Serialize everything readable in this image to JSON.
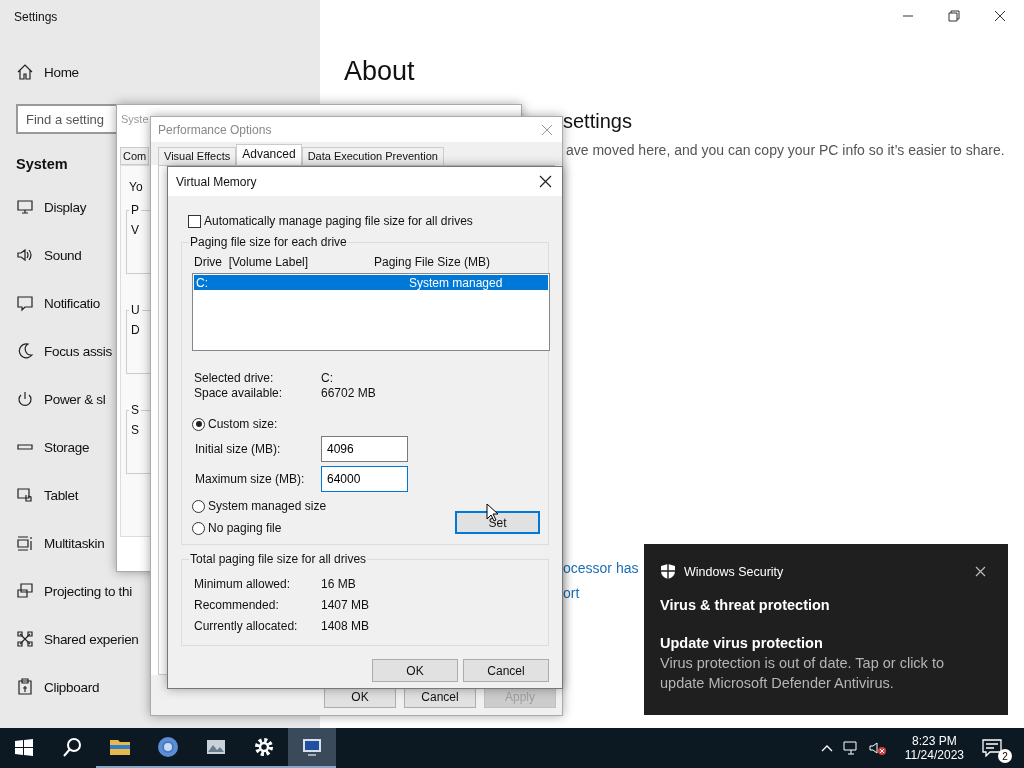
{
  "settings": {
    "title": "Settings",
    "home": "Home",
    "search": {
      "placeholder": "Find a setting"
    },
    "section": "System",
    "items": [
      {
        "kind": "display",
        "label": "Display"
      },
      {
        "kind": "sound",
        "label": "Sound"
      },
      {
        "kind": "notifications",
        "label": "Notificatio"
      },
      {
        "kind": "focus",
        "label": "Focus assis"
      },
      {
        "kind": "power",
        "label": "Power & sl"
      },
      {
        "kind": "storage",
        "label": "Storage"
      },
      {
        "kind": "tablet",
        "label": "Tablet"
      },
      {
        "kind": "multitasking",
        "label": "Multitaskin"
      },
      {
        "kind": "projecting",
        "label": "Projecting to thi"
      },
      {
        "kind": "shared",
        "label": "Shared experien"
      },
      {
        "kind": "clipboard",
        "label": "Clipboard"
      }
    ],
    "heading": "About",
    "subheading": "settings",
    "description": "ave moved here, and you can copy your PC info so it’s easier to share.",
    "links": [
      "ocessor has",
      "ort"
    ]
  },
  "system_properties": {
    "title": "Syste",
    "tab": "Com",
    "intro": "Yo",
    "groups": [
      {
        "label": "P",
        "text": "V"
      },
      {
        "label": "U",
        "text": "D"
      },
      {
        "label": "S",
        "text": "S"
      }
    ]
  },
  "performance_options": {
    "title": "Performance Options",
    "tabs": [
      {
        "label": "Visual Effects",
        "selected": false
      },
      {
        "label": "Advanced",
        "selected": true
      },
      {
        "label": "Data Execution Prevention",
        "selected": false
      }
    ],
    "buttons": [
      {
        "label": "OK",
        "disabled": false
      },
      {
        "label": "Cancel",
        "disabled": false
      },
      {
        "label": "Apply",
        "disabled": true
      }
    ]
  },
  "virtual_memory": {
    "title": "Virtual Memory",
    "auto_manage": {
      "label": "Automatically manage paging file size for all drives",
      "checked": false
    },
    "group_title": "Paging file size for each drive",
    "columns": [
      "Drive  [Volume Label]",
      "Paging File Size (MB)"
    ],
    "drives": [
      {
        "drive": "C:",
        "size": "System managed",
        "selected": true
      }
    ],
    "info": [
      {
        "label": "Selected drive:",
        "value": "C:"
      },
      {
        "label": "Space available:",
        "value": "66702 MB"
      }
    ],
    "options": [
      {
        "kind": "radio",
        "label": "Custom size:",
        "selected": true
      },
      {
        "kind": "field",
        "label": "Initial size (MB):",
        "value": "4096",
        "focused": false
      },
      {
        "kind": "field",
        "label": "Maximum size (MB):",
        "value": "64000",
        "focused": true
      },
      {
        "kind": "radio",
        "label": "System managed size",
        "selected": false
      },
      {
        "kind": "radio",
        "label": "No paging file",
        "selected": false
      }
    ],
    "set_button": "Set",
    "totals_title": "Total paging file size for all drives",
    "totals": [
      {
        "label": "Minimum allowed:",
        "value": "16 MB"
      },
      {
        "label": "Recommended:",
        "value": "1407 MB"
      },
      {
        "label": "Currently allocated:",
        "value": "1408 MB"
      }
    ],
    "buttons": [
      "OK",
      "Cancel"
    ]
  },
  "toast": {
    "app": "Windows Security",
    "title": "Virus & threat protection",
    "heading": "Update virus protection",
    "body": "Virus protection is out of date. Tap or click to update Microsoft Defender Antivirus."
  },
  "taskbar": {
    "apps": [
      {
        "kind": "start",
        "running": false,
        "active": false
      },
      {
        "kind": "search",
        "running": false,
        "active": false
      },
      {
        "kind": "files",
        "running": true,
        "active": false
      },
      {
        "kind": "browser",
        "running": true,
        "active": false
      },
      {
        "kind": "photos",
        "running": true,
        "active": false
      },
      {
        "kind": "settings",
        "running": true,
        "active": false
      },
      {
        "kind": "system",
        "running": true,
        "active": true
      }
    ],
    "time": "8:23 PM",
    "date": "11/24/2023",
    "notification_count": "2"
  }
}
